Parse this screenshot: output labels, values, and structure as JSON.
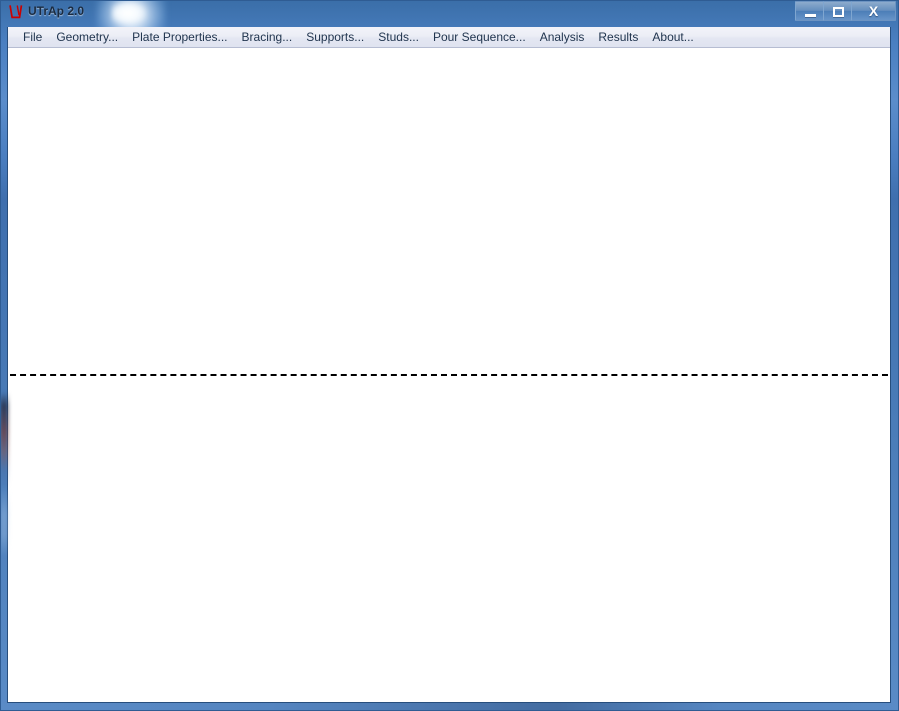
{
  "window": {
    "title": "UTrAp 2.0",
    "app_icon": "utrap-logo-icon",
    "frame_color": "#4a7cb8",
    "accent_color": "#3a6ea8",
    "logo_color": "#cc0000"
  },
  "window_controls": [
    {
      "name": "minimize",
      "label": "",
      "glyph": "minimize-icon"
    },
    {
      "name": "maximize",
      "label": "",
      "glyph": "maximize-icon"
    },
    {
      "name": "close",
      "label": "X",
      "glyph": "close-icon"
    }
  ],
  "menubar": {
    "items": [
      {
        "label": "File"
      },
      {
        "label": "Geometry..."
      },
      {
        "label": "Plate Properties..."
      },
      {
        "label": "Bracing..."
      },
      {
        "label": "Supports..."
      },
      {
        "label": "Studs..."
      },
      {
        "label": "Pour Sequence..."
      },
      {
        "label": "Analysis"
      },
      {
        "label": "Results"
      },
      {
        "label": "About..."
      }
    ]
  },
  "content": {
    "upper_panel": {
      "text": ""
    },
    "lower_panel": {
      "text": ""
    },
    "divider_style": "dashed",
    "divider_color": "#000000",
    "background_color": "#ffffff"
  }
}
